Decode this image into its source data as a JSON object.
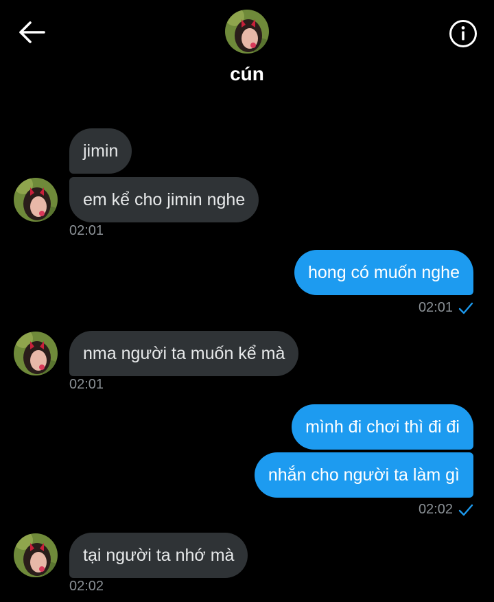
{
  "header": {
    "back_icon": "arrow-left-icon",
    "info_icon": "info-circle-icon",
    "contact_name": "cún"
  },
  "colors": {
    "background": "#000000",
    "incoming_bubble": "#2f3336",
    "outgoing_bubble": "#1d9bf0",
    "timestamp": "#8b9196",
    "read_check": "#1d9bf0"
  },
  "messages": [
    {
      "dir": "in",
      "text": "jimin"
    },
    {
      "dir": "in",
      "text": "em kể cho jimin nghe",
      "time": "02:01"
    },
    {
      "dir": "out",
      "text": "hong có muốn nghe",
      "time": "02:01"
    },
    {
      "dir": "in",
      "text": "nma người ta muốn kể mà",
      "time": "02:01"
    },
    {
      "dir": "out",
      "text": "mình đi chơi thì đi đi"
    },
    {
      "dir": "out",
      "text": "nhắn cho người ta làm gì",
      "time": "02:02"
    },
    {
      "dir": "in",
      "text": "tại người ta nhớ mà",
      "time": "02:02"
    }
  ]
}
